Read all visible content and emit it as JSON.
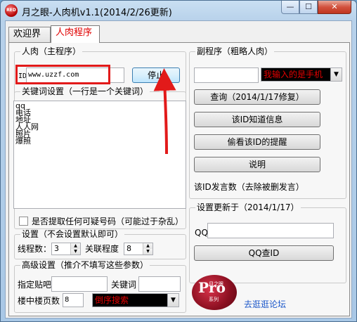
{
  "window": {
    "title": "月之眼-人肉机v1.1(2014/2/26更新)",
    "icon_text": "RED",
    "controls": {
      "minimize": "—",
      "maximize": "☐",
      "close": "✕"
    }
  },
  "tabs": [
    {
      "label": "欢迎界面"
    },
    {
      "label": "人肉程序"
    }
  ],
  "main_program": {
    "group_title": "人肉（主程序）",
    "id_label": "ID",
    "id_value": "www.uzzf.com",
    "stop_button": "停止",
    "keyword_group_title": "关键词设置（一行是一个关键词）",
    "keywords": [
      "qq",
      "电话",
      "地址",
      "人人网",
      "照片",
      "爆照"
    ],
    "extract_checkbox_label": "是否提取任何可疑号码（可能过于杂乱）"
  },
  "settings": {
    "group_title": "设置（不会设置默认即可）",
    "threads_label": "线程数：",
    "threads_value": "3",
    "relevance_label": "关联程度",
    "relevance_value": "8"
  },
  "advanced": {
    "group_title": "高级设置（推介不填写这些参数）",
    "post_label": "指定贴吧",
    "keyword_label": "关键词",
    "pages_label": "楼中楼页数",
    "pages_value": "8",
    "order_combo": "倒序搜索"
  },
  "sub_program": {
    "group_title": "副程序（粗略人肉）",
    "combo_text": "我输入的是手机",
    "buttons": [
      "查询（2014/1/17修复）",
      "该ID知道信息",
      "偷看该ID的提醒",
      "说明"
    ],
    "post_count_label": "该ID发言数（去除被删发言）"
  },
  "settings_update": {
    "group_title": "设置更新于（2014/1/17）",
    "qq_label": "QQ",
    "qq_button": "QQ查ID"
  },
  "logo": {
    "big": "Pro",
    "small": "月之眼",
    "sub": "系列"
  },
  "forum_link": "去逛逛论坛",
  "colors": {
    "accent_red": "#e21a1a",
    "tab_active_text": "#e00000",
    "link": "#1a56c9"
  }
}
